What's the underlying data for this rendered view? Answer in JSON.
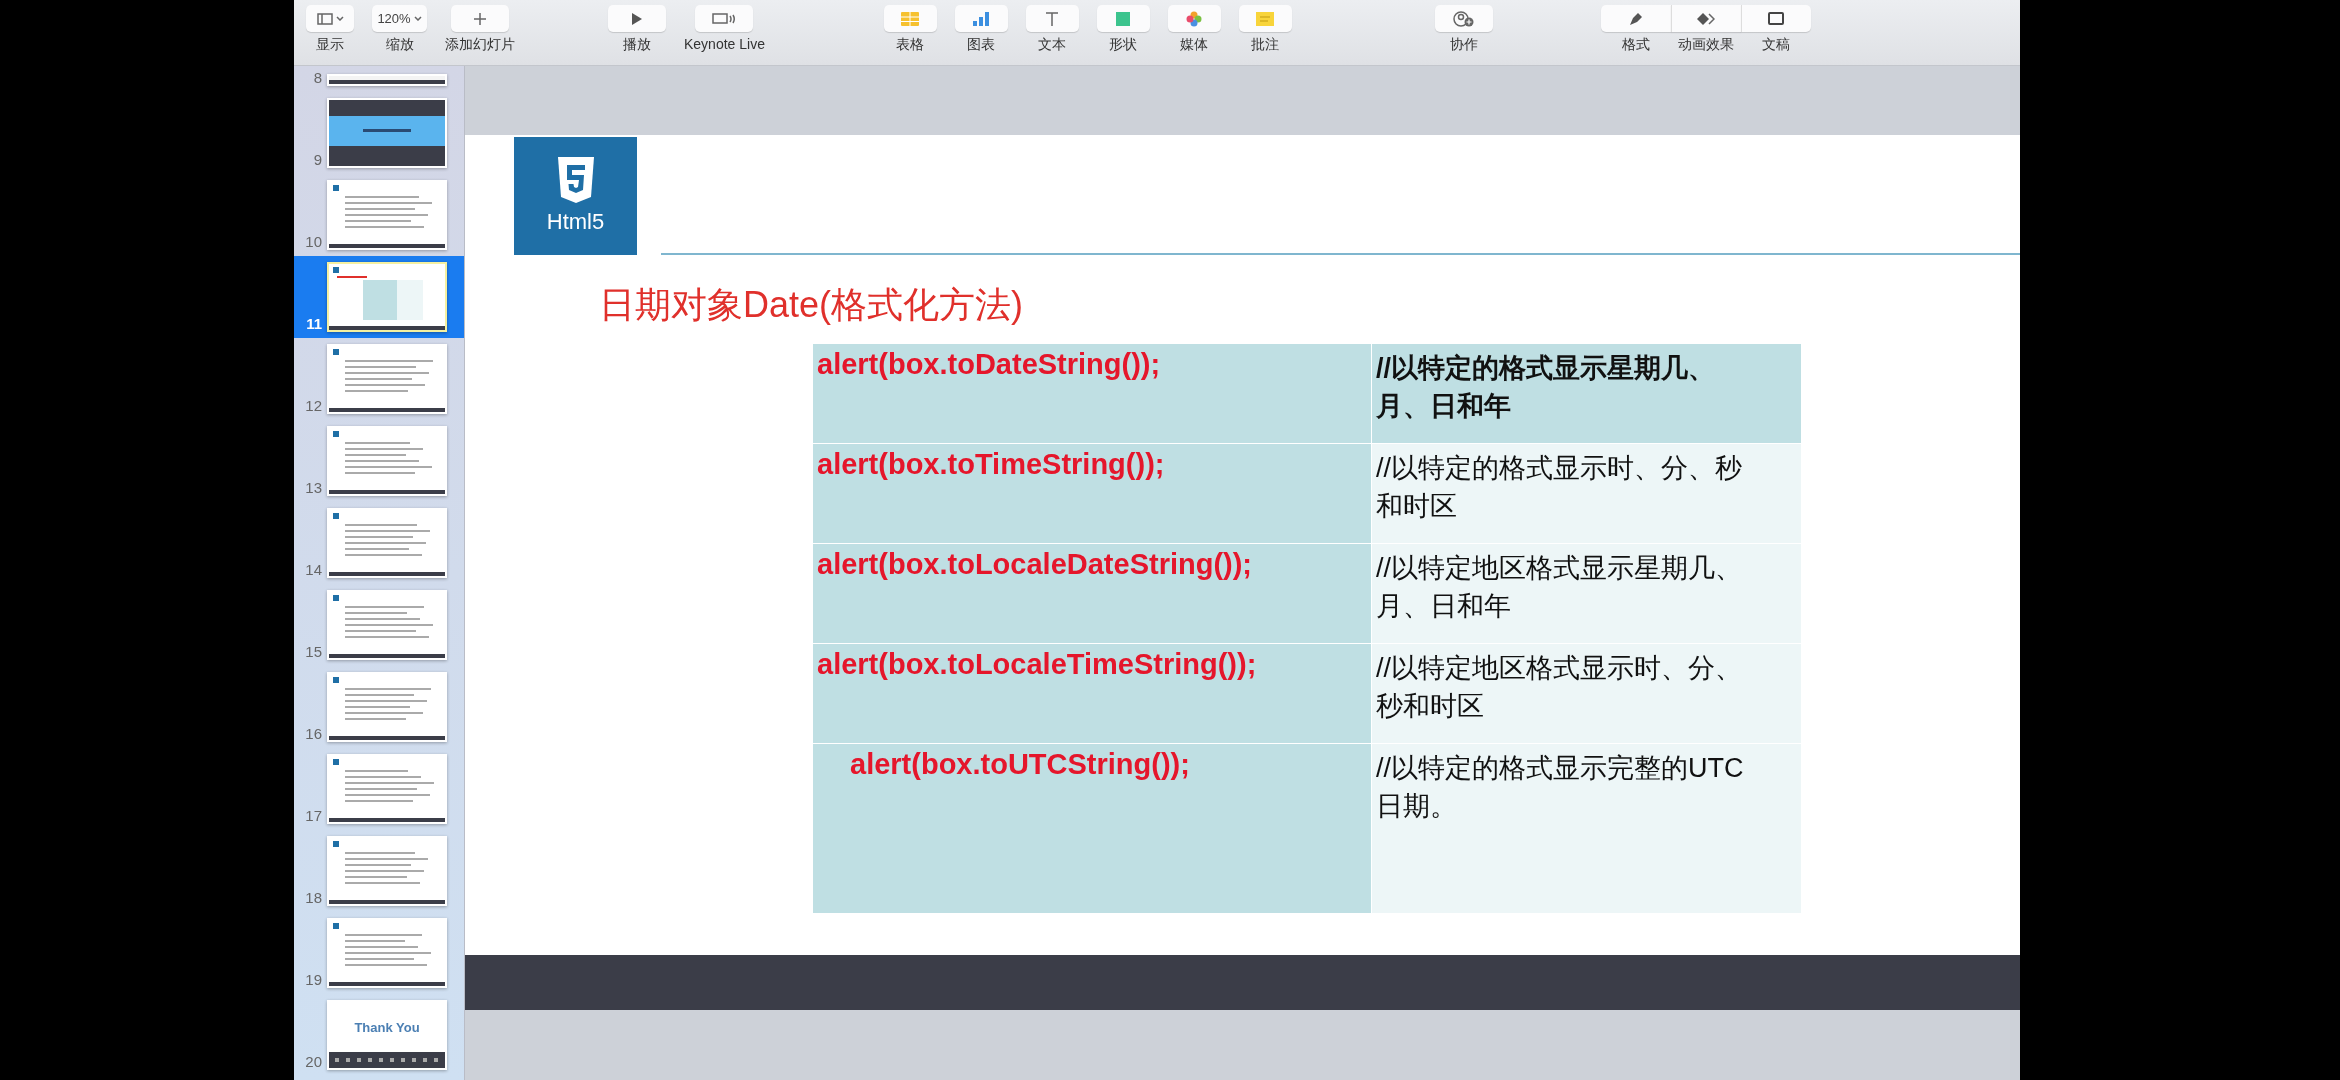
{
  "toolbar": {
    "groups": [
      {
        "items": [
          {
            "label": "显示",
            "kind": "view"
          },
          {
            "label": "缩放",
            "kind": "zoom",
            "value": "120%"
          },
          {
            "label": "添加幻灯片",
            "kind": "add"
          }
        ]
      },
      {
        "items": [
          {
            "label": "播放",
            "kind": "play"
          },
          {
            "label": "Keynote Live",
            "kind": "live"
          }
        ]
      },
      {
        "items": [
          {
            "label": "表格",
            "kind": "table"
          },
          {
            "label": "图表",
            "kind": "chart"
          },
          {
            "label": "文本",
            "kind": "text"
          },
          {
            "label": "形状",
            "kind": "shape"
          },
          {
            "label": "媒体",
            "kind": "media"
          },
          {
            "label": "批注",
            "kind": "comment"
          }
        ]
      },
      {
        "items": [
          {
            "label": "协作",
            "kind": "collab"
          }
        ]
      },
      {
        "items": [
          {
            "label": "格式",
            "kind": "format"
          },
          {
            "label": "动画效果",
            "kind": "animate"
          },
          {
            "label": "文稿",
            "kind": "document"
          }
        ]
      }
    ]
  },
  "sidebar": {
    "slides": [
      {
        "number": "8",
        "selected": false,
        "kind": "partial"
      },
      {
        "number": "9",
        "selected": false,
        "kind": "section"
      },
      {
        "number": "10",
        "selected": false,
        "kind": "text"
      },
      {
        "number": "11",
        "selected": true,
        "kind": "table"
      },
      {
        "number": "12",
        "selected": false,
        "kind": "text"
      },
      {
        "number": "13",
        "selected": false,
        "kind": "text"
      },
      {
        "number": "14",
        "selected": false,
        "kind": "text"
      },
      {
        "number": "15",
        "selected": false,
        "kind": "text"
      },
      {
        "number": "16",
        "selected": false,
        "kind": "text"
      },
      {
        "number": "17",
        "selected": false,
        "kind": "text"
      },
      {
        "number": "18",
        "selected": false,
        "kind": "text"
      },
      {
        "number": "19",
        "selected": false,
        "kind": "text"
      },
      {
        "number": "20",
        "selected": false,
        "kind": "thanks",
        "title": "Thank You"
      }
    ]
  },
  "slide": {
    "logo_text": "Html5",
    "title": "日期对象Date(格式化方法)",
    "table": {
      "rows": [
        {
          "code": "alert(box.toDateString());",
          "note": "//以特定的格式显示星期几、月、日和年",
          "emphasized": true,
          "indented": false
        },
        {
          "code": "alert(box.toTimeString());",
          "note": "//以特定的格式显示时、分、秒和时区",
          "emphasized": false,
          "indented": false
        },
        {
          "code": "alert(box.toLocaleDateString());",
          "note": "//以特定地区格式显示星期几、月、日和年",
          "emphasized": false,
          "indented": false
        },
        {
          "code": "alert(box.toLocaleTimeString());",
          "note": "//以特定地区格式显示时、分、秒和时区",
          "emphasized": false,
          "indented": false
        },
        {
          "code": "alert(box.toUTCString());",
          "note": "//以特定的格式显示完整的UTC 日期。",
          "emphasized": false,
          "indented": true
        }
      ]
    }
  }
}
